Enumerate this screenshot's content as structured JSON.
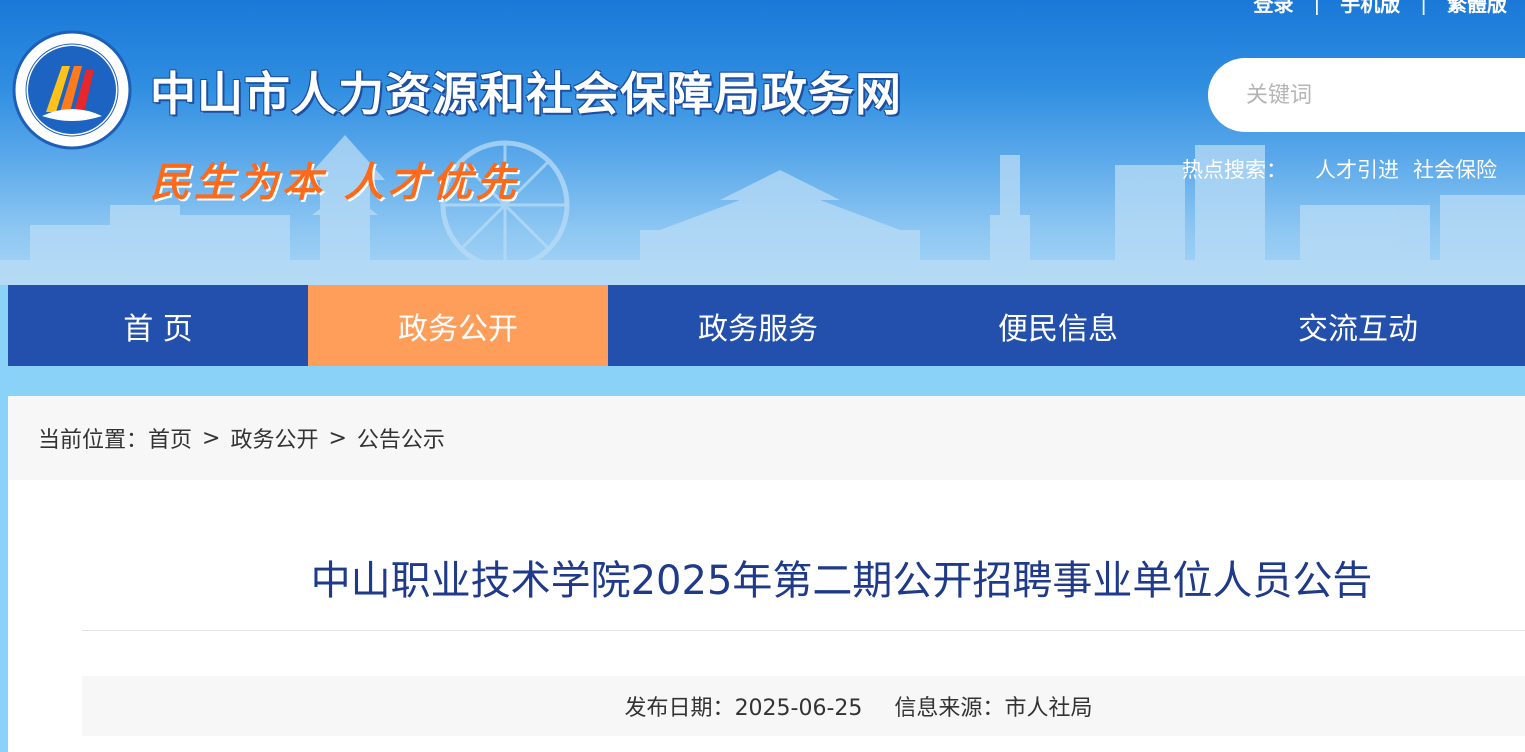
{
  "header": {
    "top_links": [
      "登录",
      "手机版",
      "繁體版"
    ],
    "site_title": "中山市人力资源和社会保障局政务网",
    "slogan": "民生为本 人才优先",
    "search": {
      "placeholder": "关键词"
    },
    "hot_search": {
      "label": "热点搜索：",
      "items": [
        "人才引进",
        "社会保险"
      ]
    }
  },
  "nav": {
    "items": [
      {
        "label": "首 页"
      },
      {
        "label": "政务公开",
        "active": true
      },
      {
        "label": "政务服务"
      },
      {
        "label": "便民信息"
      },
      {
        "label": "交流互动"
      }
    ]
  },
  "breadcrumb": {
    "prefix": "当前位置：",
    "items": [
      "首页",
      "政务公开",
      "公告公示"
    ],
    "separator": ">"
  },
  "article": {
    "title": "中山职业技术学院2025年第二期公开招聘事业单位人员公告",
    "publish_date_label": "发布日期：",
    "publish_date": "2025-06-25",
    "source_label": "信息来源：",
    "source": "市人社局"
  },
  "colors": {
    "nav_bg": "#2450ad",
    "nav_active": "#ff9e5a",
    "title_color": "#1f3a8a",
    "slogan_color": "#ff6a1a"
  }
}
